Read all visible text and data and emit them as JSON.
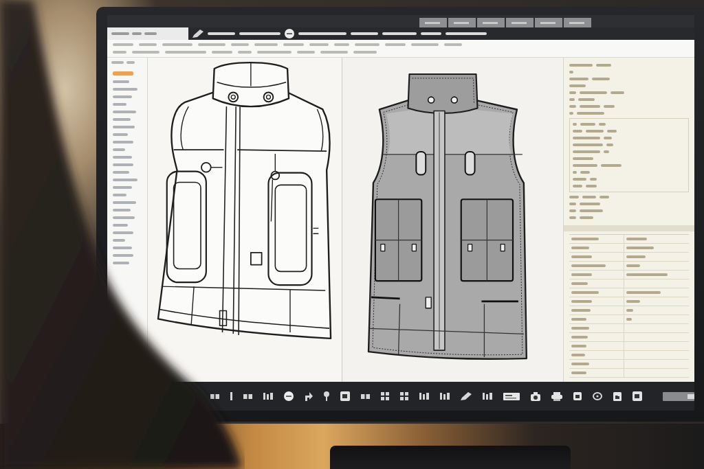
{
  "screen": {
    "sidebar": {
      "items": [
        {
          "selected": true
        },
        {
          "selected": false
        },
        {
          "selected": false
        },
        {
          "selected": false
        },
        {
          "selected": false
        },
        {
          "selected": false
        },
        {
          "selected": false
        },
        {
          "selected": false
        },
        {
          "selected": false
        },
        {
          "selected": false
        },
        {
          "selected": false
        },
        {
          "selected": false
        },
        {
          "selected": false
        },
        {
          "selected": false
        },
        {
          "selected": false
        },
        {
          "selected": false
        },
        {
          "selected": false
        },
        {
          "selected": false
        },
        {
          "selected": false
        },
        {
          "selected": false
        },
        {
          "selected": false
        },
        {
          "selected": false
        },
        {
          "selected": false
        },
        {
          "selected": false
        },
        {
          "selected": false
        },
        {
          "selected": false
        }
      ]
    },
    "canvas": {
      "drawings": [
        {
          "kind": "outline"
        },
        {
          "kind": "shaded"
        }
      ]
    }
  }
}
